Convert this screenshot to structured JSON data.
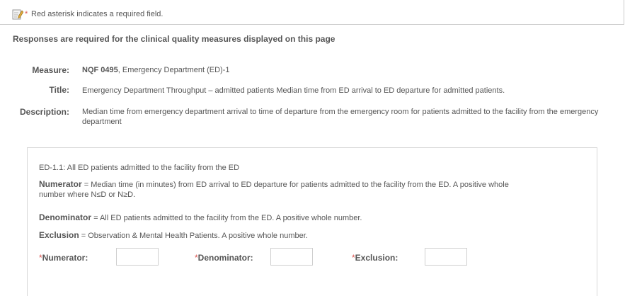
{
  "notice": {
    "icon": "edit-note-icon",
    "star": "*",
    "text": "Red asterisk indicates a required field."
  },
  "heading": "Responses are required for the clinical quality measures displayed on this page",
  "measure": {
    "label": "Measure:",
    "code": "NQF 0495",
    "rest": ", Emergency Department (ED)-1"
  },
  "title": {
    "label": "Title:",
    "value": "Emergency Department Throughput – admitted patients Median time from ED arrival to ED departure for admitted patients."
  },
  "description": {
    "label": "Description:",
    "value": "Median time from emergency department arrival to time of departure from the emergency room for patients admitted to the facility from the emergency department"
  },
  "panel": {
    "intro": "ED-1.1: All ED patients admitted to the facility from the ED",
    "numerator_term": "Numerator",
    "numerator_text": " = Median time (in minutes) from ED arrival to ED departure for patients admitted to the facility from the ED. A positive whole number where N≤D or N≥D.",
    "denominator_term": "Denominator",
    "denominator_text": " = All ED patients admitted to the facility from the ED. A positive whole number.",
    "exclusion_term": "Exclusion",
    "exclusion_text": " = Observation & Mental Health Patients. A positive whole number."
  },
  "fields": {
    "required_mark": "*",
    "numerator_label": "Numerator:",
    "numerator_value": "",
    "denominator_label": "Denominator:",
    "denominator_value": "",
    "exclusion_label": "Exclusion:",
    "exclusion_value": ""
  },
  "colors": {
    "required": "#d9534f",
    "text": "#555555",
    "border": "#d8d8d8"
  }
}
